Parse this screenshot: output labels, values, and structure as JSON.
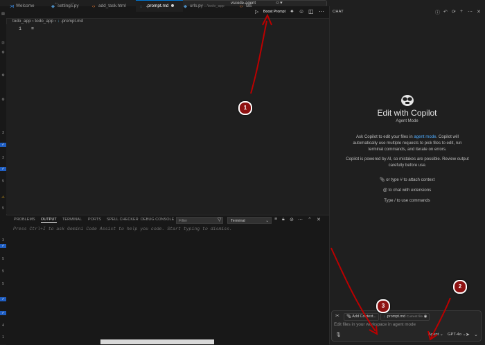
{
  "title_bar": {
    "search_text": "vscode-agent"
  },
  "activity_bar": {
    "labels": [
      "3",
      "3",
      "5",
      "5",
      "3",
      "5",
      "5",
      "5",
      "4",
      "1"
    ]
  },
  "tabs": [
    {
      "label": "Welcome",
      "icon": "vscode-logo-icon"
    },
    {
      "label": "settings.py",
      "icon": "python-file-icon"
    },
    {
      "label": "add_task.html",
      "icon": "html-file-icon"
    },
    {
      "label": ".prompt.md",
      "icon": "markdown-file-icon",
      "active": true,
      "modified": true
    },
    {
      "label": "urls.py",
      "sub": "...\\todo_app",
      "icon": "python-file-icon"
    },
    {
      "label": "tas",
      "icon": "html-file-icon"
    }
  ],
  "tab_actions": {
    "run_label": "Boost Prompt"
  },
  "breadcrumb": [
    "todo_app",
    "todo_app",
    ".prompt.md"
  ],
  "editor": {
    "line_number": "1",
    "line_text": "≡"
  },
  "panel": {
    "tabs": [
      "PROBLEMS",
      "OUTPUT",
      "TERMINAL",
      "PORTS",
      "SPELL CHECKER",
      "DEBUG CONSOLE"
    ],
    "active_tab": "OUTPUT",
    "filter_placeholder": "Filter",
    "channel": "Terminal",
    "hint": "Press Ctrl+I to ask Gemini Code Assist to help you code. Start typing to dismiss."
  },
  "chat": {
    "header": "CHAT",
    "title": "Edit with Copilot",
    "mode": "Agent Mode",
    "desc_pre": "Ask Copilot to edit your files in ",
    "desc_link": "agent mode",
    "desc_post": ". Copilot will automatically use multiple requests to pick files to edit, run terminal commands, and iterate on errors.",
    "warning": "Copilot is powered by AI, so mistakes are possible. Review output carefully before use.",
    "hints": [
      "or type # to attach context",
      "to chat with extensions",
      "Type / to use commands"
    ],
    "add_context": "Add Context...",
    "current_file_name": ".prompt.md",
    "current_file_label": "Current file",
    "input_placeholder": "Edit files in your workspace in agent mode",
    "agent_label": "Agent",
    "model_label": "GPT-4o"
  },
  "callouts": [
    "1",
    "2",
    "3"
  ],
  "colors": {
    "accent": "#0078d4",
    "link": "#4daafc",
    "callout": "#8e1212",
    "background": "#1f1f1f"
  }
}
